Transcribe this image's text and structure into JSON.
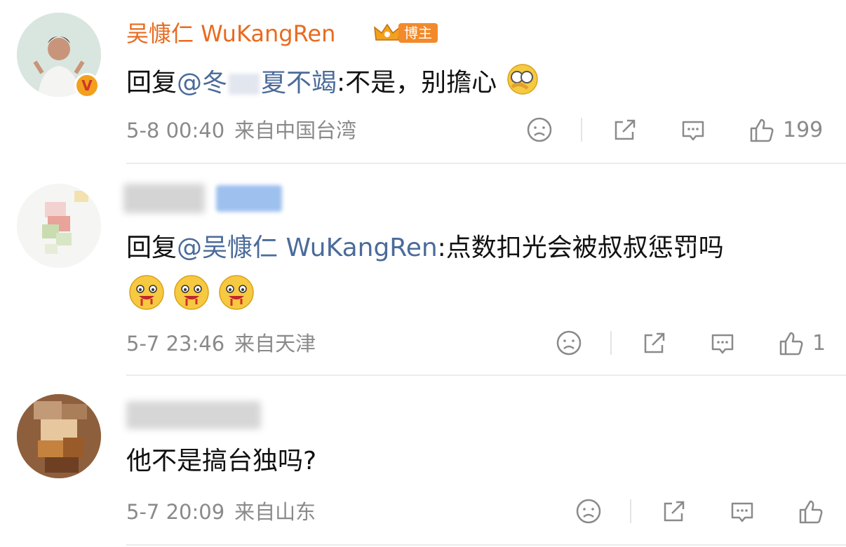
{
  "comments": [
    {
      "author": "吴慷仁 WuKangRen",
      "badge": "博主",
      "reply_prefix": "回复",
      "mention": "@冬",
      "mention_tail": "夏不竭",
      "text": ":不是，别擔心",
      "emoji": "facepalm-emoji",
      "time": "5-8 00:40",
      "location": "来自中国台湾",
      "likes": "199"
    },
    {
      "author": "",
      "reply_prefix": "回复",
      "mention": "@吴慷仁 WuKangRen",
      "text": ":点数扣光会被叔叔惩罚吗",
      "emoji": "drooling-emoji",
      "time": "5-7 23:46",
      "location": "来自天津",
      "likes": "1"
    },
    {
      "author": "",
      "text": "他不是搞台独吗?",
      "time": "5-7 20:09",
      "location": "来自山东",
      "likes": ""
    }
  ],
  "colors": {
    "author_name": "#e86b1f",
    "mention": "#4b6b9a",
    "meta": "#8a8a8a",
    "badge_bg": "#f28a2b",
    "verified_badge": "#f2a11d"
  },
  "icons": [
    "dislike-icon",
    "share-icon",
    "comment-icon",
    "like-icon"
  ]
}
